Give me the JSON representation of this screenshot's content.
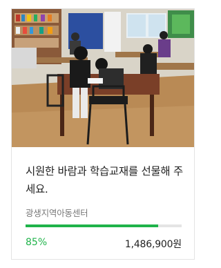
{
  "campaign": {
    "title": "시원한 바람과 학습교재를 선물해 주세요.",
    "organization": "광생지역아동센터",
    "progress_percent_label": "85%",
    "progress_fraction": 0.85,
    "amount": "1,486,900원",
    "photo_alt": "children-studying-classroom-photo"
  },
  "colors": {
    "accent": "#1fb34a",
    "track": "#e4e4e4",
    "border": "#e3e3e3"
  }
}
